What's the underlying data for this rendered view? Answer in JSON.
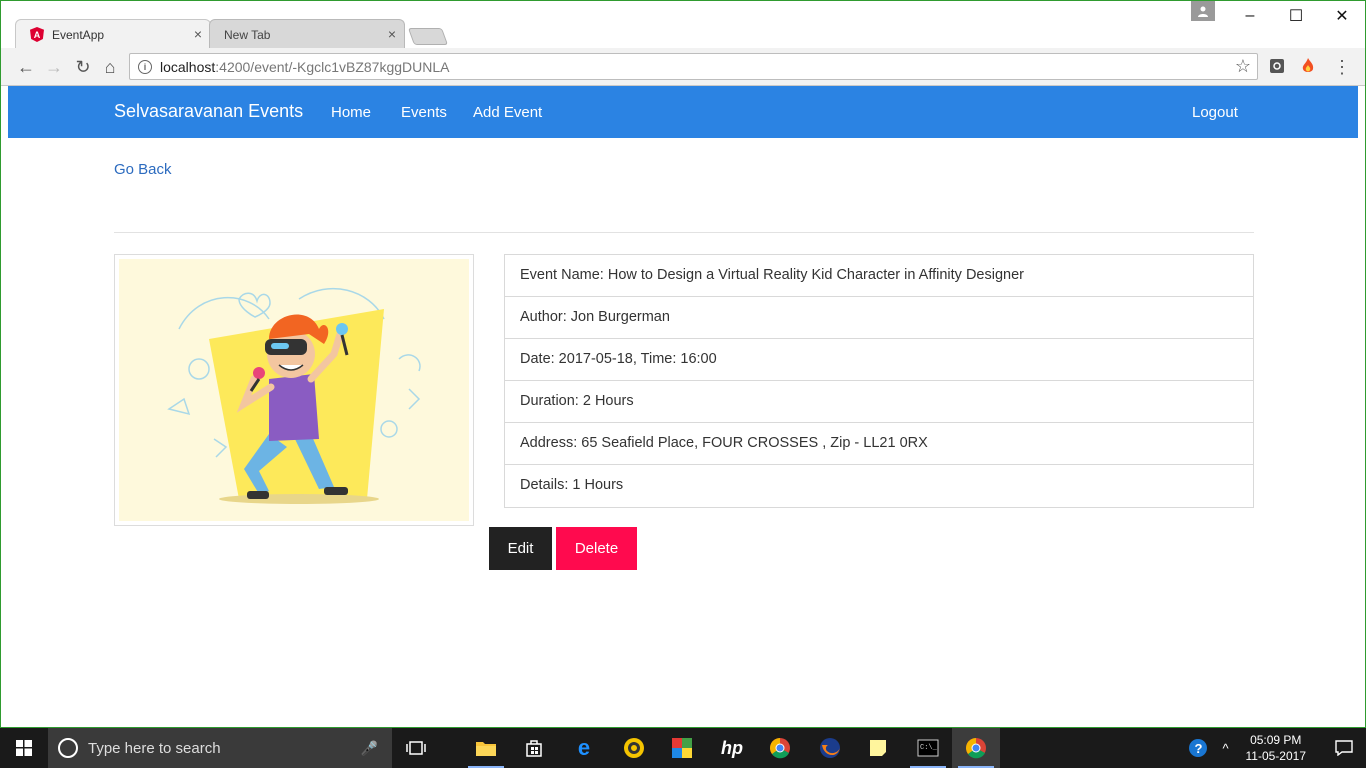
{
  "browser": {
    "tabs": [
      {
        "title": "EventApp",
        "close": "×"
      },
      {
        "title": "New Tab",
        "close": "×"
      }
    ],
    "url_host": "localhost",
    "url_path": ":4200/event/-Kgclc1vBZ87kggDUNLA",
    "window_controls": {
      "minimize": "–",
      "maximize": "☐",
      "close": "✕"
    },
    "nav_icons": {
      "back": "←",
      "forward": "→",
      "reload": "↻",
      "home": "⌂",
      "star": "☆",
      "menu": "⋮"
    }
  },
  "navbar": {
    "brand": "Selvasaravanan Events",
    "links": [
      "Home",
      "Events",
      "Add Event"
    ],
    "logout": "Logout",
    "color": "#2b83e3"
  },
  "page": {
    "go_back": "Go Back",
    "image_alt": "Virtual reality kid character",
    "details": [
      "Event Name: How to Design a Virtual Reality Kid Character in Affinity Designer",
      "Author: Jon Burgerman",
      "Date: 2017-05-18, Time: 16:00",
      "Duration: 2 Hours",
      "Address: 65 Seafield Place, FOUR CROSSES , Zip - LL21 0RX",
      "Details: 1 Hours"
    ],
    "edit_label": "Edit",
    "delete_label": "Delete",
    "delete_color": "#ff0a4e"
  },
  "taskbar": {
    "search_placeholder": "Type here to search",
    "time": "05:09 PM",
    "date": "11-05-2017"
  }
}
